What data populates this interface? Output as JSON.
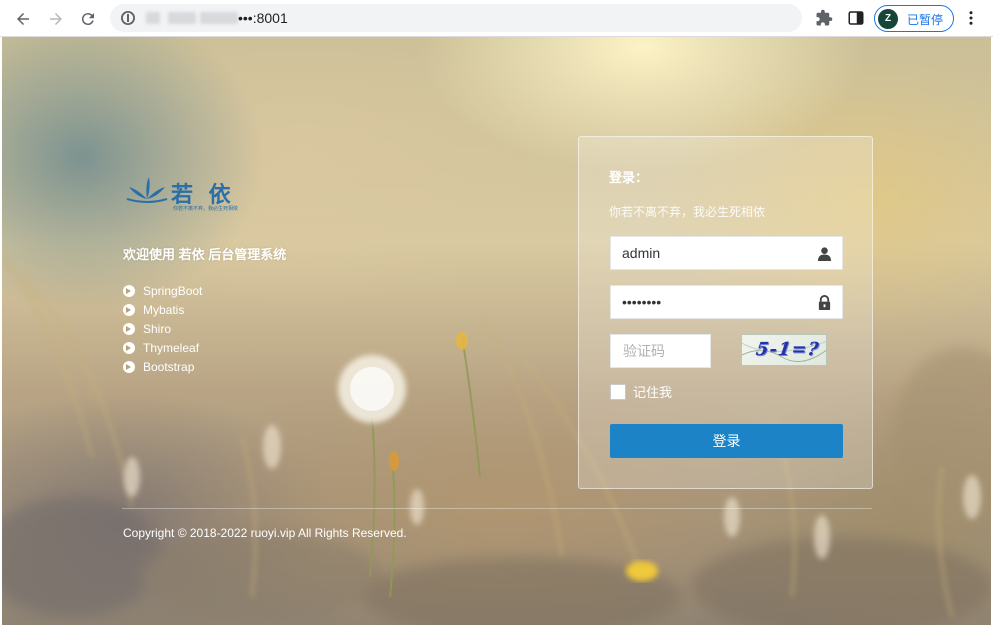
{
  "browser": {
    "url_visible": "•••:8001",
    "profile_initial": "Z",
    "profile_status": "已暂停"
  },
  "intro": {
    "logo_text": "若 依",
    "logo_tagline": "你若不离不弃，我必生死相依",
    "welcome": "欢迎使用 若依 后台管理系统",
    "features": [
      "SpringBoot",
      "Mybatis",
      "Shiro",
      "Thymeleaf",
      "Bootstrap"
    ]
  },
  "login": {
    "title": "登录：",
    "subtitle": "你若不离不弃，我必生死相依",
    "username": "admin",
    "password": "admin123",
    "captcha_placeholder": "验证码",
    "captcha_text": "5-1=?",
    "remember_label": "记住我",
    "submit_label": "登录"
  },
  "footer": {
    "copyright": "Copyright © 2018-2022 ruoyi.vip All Rights Reserved."
  },
  "colors": {
    "button": "#1c84c6",
    "logo": "#2a6fa8",
    "chip_border": "#1a73e8"
  }
}
